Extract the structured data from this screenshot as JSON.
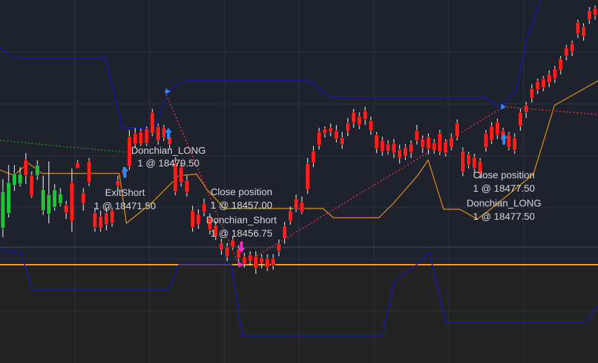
{
  "chart_data": {
    "type": "candlestick",
    "instrument_hint": "",
    "y_range_estimate": [
      18440,
      18500
    ],
    "colors": {
      "background": "#1e222d",
      "lower_zone": "#222222",
      "grid": "#2c3140",
      "up_candle": "#22c33a",
      "down_candle": "#ff1f1f",
      "wick": "#ffffff",
      "donchian_band": "#1818a8",
      "midline": "#e8941a",
      "support_line": "#ffa020",
      "trade_line_win": "#e8324a",
      "trade_line_other": "#1f8f2f",
      "buy_arrow": "#2a8cff",
      "sell_arrow": "#ff28d0"
    },
    "candles": [
      [
        1,
        325,
        273,
        338,
        255
      ],
      [
        2,
        304,
        260,
        310,
        235
      ],
      [
        3,
        264,
        247,
        272,
        235
      ],
      [
        4,
        262,
        248,
        266,
        238
      ],
      [
        5,
        228,
        250,
        218,
        262
      ],
      [
        6,
        250,
        279,
        244,
        282
      ],
      [
        7,
        250,
        235,
        256,
        228
      ],
      [
        8,
        300,
        270,
        306,
        250
      ],
      [
        9,
        305,
        277,
        318,
        230
      ],
      [
        10,
        295,
        270,
        300,
        262
      ],
      [
        11,
        290,
        276,
        294,
        268
      ],
      [
        12,
        292,
        303,
        286,
        312
      ],
      [
        13,
        260,
        315,
        240,
        330
      ],
      [
        14,
        232,
        240,
        228,
        236
      ],
      [
        15,
        275,
        290,
        268,
        300
      ],
      [
        16,
        230,
        260,
        225,
        265
      ],
      [
        17,
        303,
        324,
        296,
        330
      ],
      [
        18,
        308,
        325,
        300,
        330
      ],
      [
        19,
        303,
        320,
        296,
        328
      ],
      [
        20,
        300,
        318,
        296,
        323
      ],
      [
        21,
        257,
        265,
        250,
        272
      ],
      [
        22,
        244,
        248,
        238,
        250
      ],
      [
        23,
        195,
        237,
        185,
        242
      ],
      [
        24,
        190,
        205,
        182,
        210
      ],
      [
        25,
        188,
        205,
        183,
        208
      ],
      [
        26,
        184,
        204,
        180,
        208
      ],
      [
        27,
        160,
        190,
        155,
        194
      ],
      [
        28,
        180,
        200,
        176,
        206
      ],
      [
        29,
        182,
        196,
        178,
        201
      ],
      [
        30,
        195,
        206,
        190,
        212
      ],
      [
        31,
        232,
        273,
        224,
        278
      ],
      [
        32,
        238,
        260,
        232,
        266
      ],
      [
        33,
        257,
        274,
        250,
        280
      ],
      [
        34,
        300,
        324,
        293,
        330
      ],
      [
        35,
        305,
        320,
        298,
        326
      ],
      [
        36,
        290,
        302,
        283,
        308
      ],
      [
        37,
        310,
        327,
        304,
        334
      ],
      [
        38,
        321,
        337,
        315,
        342
      ],
      [
        39,
        346,
        356,
        340,
        363
      ],
      [
        40,
        352,
        365,
        346,
        372
      ],
      [
        41,
        342,
        352,
        336,
        355
      ],
      [
        42,
        355,
        368,
        349,
        374
      ],
      [
        43,
        366,
        376,
        360,
        381
      ],
      [
        44,
        363,
        372,
        358,
        378
      ],
      [
        45,
        365,
        382,
        358,
        390
      ],
      [
        46,
        367,
        375,
        362,
        382
      ],
      [
        47,
        368,
        381,
        362,
        386
      ],
      [
        48,
        368,
        378,
        362,
        384
      ],
      [
        49,
        347,
        358,
        341,
        365
      ],
      [
        50,
        322,
        340,
        316,
        347
      ],
      [
        51,
        300,
        315,
        294,
        320
      ],
      [
        52,
        283,
        297,
        277,
        302
      ],
      [
        53,
        288,
        302,
        280,
        305
      ],
      [
        54,
        233,
        270,
        225,
        276
      ],
      [
        55,
        215,
        232,
        208,
        238
      ],
      [
        56,
        188,
        207,
        182,
        213
      ],
      [
        57,
        184,
        190,
        180,
        196
      ],
      [
        58,
        182,
        188,
        176,
        194
      ],
      [
        59,
        186,
        198,
        178,
        203
      ],
      [
        60,
        196,
        206,
        188,
        212
      ],
      [
        61,
        175,
        187,
        168,
        194
      ],
      [
        62,
        160,
        175,
        155,
        182
      ],
      [
        63,
        166,
        178,
        160,
        184
      ],
      [
        64,
        158,
        170,
        152,
        178
      ],
      [
        65,
        172,
        186,
        166,
        192
      ],
      [
        66,
        192,
        212,
        188,
        218
      ],
      [
        67,
        200,
        216,
        195,
        222
      ],
      [
        68,
        205,
        215,
        200,
        220
      ],
      [
        69,
        204,
        218,
        198,
        225
      ],
      [
        70,
        213,
        225,
        206,
        233
      ],
      [
        71,
        210,
        223,
        205,
        228
      ],
      [
        72,
        205,
        217,
        200,
        225
      ],
      [
        73,
        186,
        200,
        178,
        206
      ],
      [
        74,
        198,
        210,
        193,
        218
      ],
      [
        75,
        195,
        212,
        190,
        220
      ],
      [
        76,
        203,
        214,
        198,
        219
      ],
      [
        77,
        190,
        216,
        185,
        221
      ],
      [
        78,
        202,
        218,
        198,
        223
      ],
      [
        79,
        196,
        210,
        190,
        214
      ],
      [
        80,
        175,
        195,
        170,
        200
      ],
      [
        81,
        215,
        245,
        210,
        251
      ],
      [
        82,
        220,
        235,
        216,
        240
      ],
      [
        83,
        224,
        240,
        219,
        246
      ],
      [
        84,
        230,
        248,
        225,
        254
      ],
      [
        85,
        190,
        210,
        185,
        216
      ],
      [
        86,
        180,
        200,
        174,
        205
      ],
      [
        87,
        174,
        192,
        169,
        198
      ],
      [
        88,
        186,
        200,
        182,
        206
      ],
      [
        89,
        192,
        210,
        188,
        214
      ],
      [
        90,
        196,
        214,
        190,
        219
      ],
      [
        91,
        160,
        180,
        155,
        186
      ],
      [
        92,
        150,
        160,
        145,
        168
      ],
      [
        93,
        126,
        140,
        120,
        146
      ],
      [
        94,
        116,
        128,
        112,
        134
      ],
      [
        95,
        112,
        125,
        108,
        130
      ],
      [
        96,
        106,
        118,
        100,
        124
      ],
      [
        97,
        98,
        112,
        94,
        118
      ],
      [
        98,
        84,
        100,
        80,
        106
      ],
      [
        99,
        68,
        80,
        64,
        86
      ],
      [
        100,
        62,
        74,
        58,
        80
      ],
      [
        101,
        32,
        48,
        28,
        54
      ],
      [
        102,
        38,
        52,
        33,
        58
      ],
      [
        103,
        15,
        28,
        10,
        34
      ],
      [
        104,
        12,
        22,
        8,
        28
      ]
    ],
    "candle_encoding": "[index, open_px, close_px, high_px, low_px] in relative price units mapped to the plot; up when close < open (screen coords)",
    "annotations": [
      {
        "label": "ExitShort",
        "price": "1 @ 18471.50"
      },
      {
        "label": "Donchian_LONG",
        "price": "1 @ 18479.50"
      },
      {
        "label": "Close position",
        "price": "1 @ 18457.00"
      },
      {
        "label": "Donchian_Short",
        "price": "1 @ 18456.75"
      },
      {
        "label": "Close position",
        "price": "1 @ 18477.50"
      },
      {
        "label": "Donchian_LONG",
        "price": "1 @ 18477.50"
      }
    ]
  }
}
